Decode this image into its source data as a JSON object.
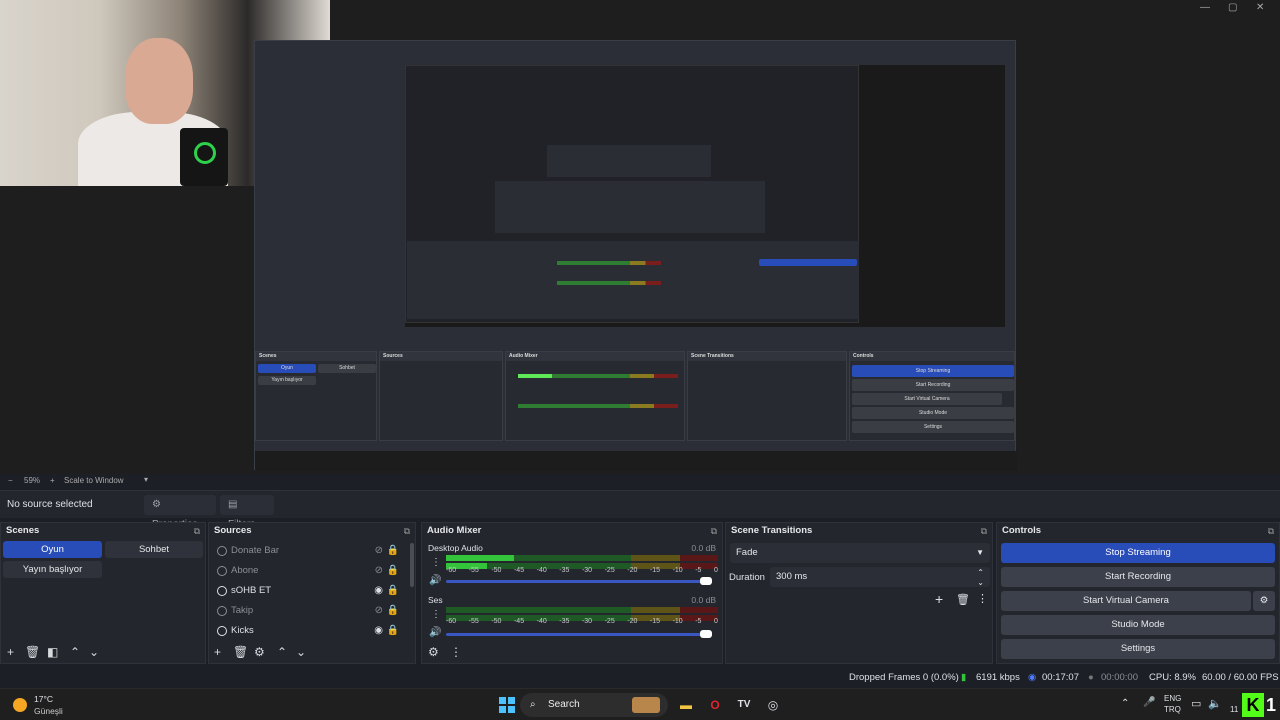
{
  "window": {
    "minimize": "—",
    "maximize": "▢",
    "close": "✕"
  },
  "preview": {
    "zoom_minus": "−",
    "zoom_level": "59%",
    "zoom_plus": "+",
    "zoom_mode": "Scale to Window"
  },
  "toolbar": {
    "selection": "No source selected",
    "properties": "Properties",
    "filters": "Filters"
  },
  "scenes": {
    "title": "Scenes",
    "items": [
      "Oyun",
      "Sohbet",
      "Yayın başlıyor"
    ],
    "active": "Oyun"
  },
  "sources": {
    "title": "Sources",
    "items": [
      {
        "name": "Donate Bar",
        "visible": false
      },
      {
        "name": "Abone",
        "visible": false
      },
      {
        "name": "sOHB ET",
        "visible": true
      },
      {
        "name": "Takip",
        "visible": false
      },
      {
        "name": "Kicks",
        "visible": true
      }
    ]
  },
  "audio_mixer": {
    "title": "Audio Mixer",
    "channels": [
      {
        "name": "Desktop Audio",
        "db": "0.0 dB",
        "level": 0.25,
        "volume": 1.0
      },
      {
        "name": "Ses",
        "db": "0.0 dB",
        "level": 0.0,
        "volume": 1.0
      }
    ],
    "ticks": [
      "-60",
      "-55",
      "-50",
      "-45",
      "-40",
      "-35",
      "-30",
      "-25",
      "-20",
      "-15",
      "-10",
      "-5",
      "0"
    ]
  },
  "scene_transitions": {
    "title": "Scene Transitions",
    "transition": "Fade",
    "duration_label": "Duration",
    "duration_value": "300 ms"
  },
  "controls": {
    "title": "Controls",
    "stop_streaming": "Stop Streaming",
    "start_recording": "Start Recording",
    "start_virtual_camera": "Start Virtual Camera",
    "studio_mode": "Studio Mode",
    "settings": "Settings"
  },
  "status": {
    "dropped_frames": "Dropped Frames 0 (0.0%)",
    "bitrate": "6191 kbps",
    "stream_time": "00:17:07",
    "rec_time": "00:00:00",
    "cpu": "CPU: 8.9%",
    "fps": "60.00 / 60.00 FPS"
  },
  "taskbar": {
    "weather_temp": "17°C",
    "weather_desc": "Güneşli",
    "search": "Search",
    "lang_top": "ENG",
    "lang_bottom": "TRQ",
    "clock_fragment": "11"
  },
  "colors": {
    "accent": "#284cb8",
    "live_green": "#34c43b"
  }
}
